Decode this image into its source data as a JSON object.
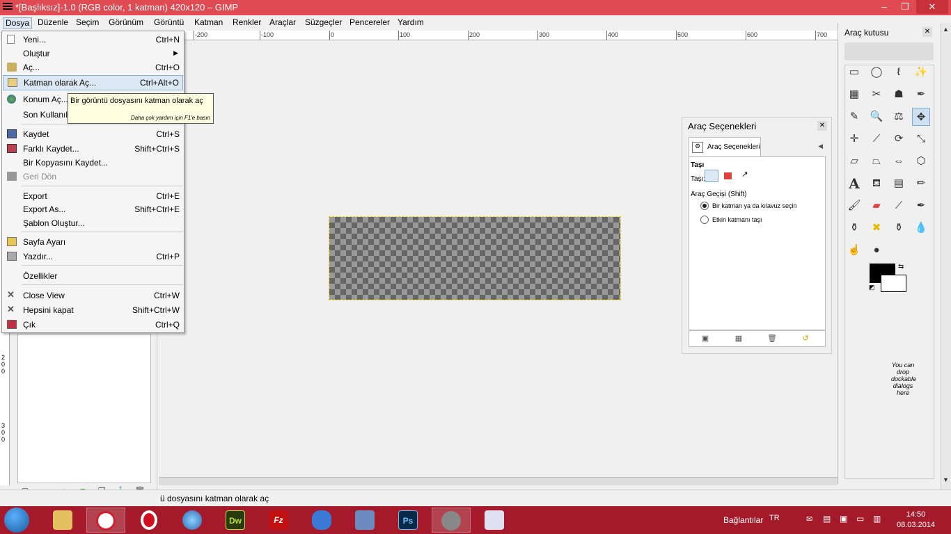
{
  "window": {
    "title": "*[Başlıksız]-1.0 (RGB color, 1 katman) 420x120 – GIMP",
    "minimize": "–",
    "maximize": "❐",
    "close": "✕"
  },
  "menubar": [
    "Dosya",
    "Düzenle",
    "Seçim",
    "Görünüm",
    "Görüntü",
    "Katman",
    "Renkler",
    "Araçlar",
    "Süzgeçler",
    "Pencereler",
    "Yardım"
  ],
  "ruler_top": [
    "-200",
    "-100",
    "0",
    "100",
    "200",
    "300",
    "400",
    "500",
    "600",
    "700"
  ],
  "ruler_left": [
    "2",
    "0",
    "0",
    "3",
    "0",
    "0"
  ],
  "file_menu": {
    "items": [
      {
        "label": "Yeni...",
        "accel": "Ctrl+N",
        "icon": "new-icon"
      },
      {
        "label": "Oluştur",
        "accel": "",
        "icon": ""
      },
      {
        "label": "Aç...",
        "accel": "Ctrl+O",
        "icon": "folder-icon"
      },
      {
        "label": "Katman olarak Aç...",
        "accel": "Ctrl+Alt+O",
        "icon": "open-as-layer-icon"
      },
      {
        "label": "Konum Aç...",
        "accel": "",
        "icon": "globe-icon"
      },
      {
        "label": "Son Kullanılan",
        "accel": "",
        "icon": ""
      },
      {
        "label": "Kaydet",
        "accel": "Ctrl+S",
        "icon": "save-icon"
      },
      {
        "label": "Farklı Kaydet...",
        "accel": "Shift+Ctrl+S",
        "icon": "save-as-icon"
      },
      {
        "label": "Bir Kopyasını Kaydet...",
        "accel": "",
        "icon": ""
      },
      {
        "label": "Geri Dön",
        "accel": "",
        "icon": "revert-icon"
      },
      {
        "label": "Export",
        "accel": "Ctrl+E",
        "icon": ""
      },
      {
        "label": "Export As...",
        "accel": "Shift+Ctrl+E",
        "icon": ""
      },
      {
        "label": "Şablon Oluştur...",
        "accel": "",
        "icon": ""
      },
      {
        "label": "Sayfa Ayarı",
        "accel": "",
        "icon": "page-setup-icon"
      },
      {
        "label": "Yazdır...",
        "accel": "Ctrl+P",
        "icon": "print-icon"
      },
      {
        "label": "Özellikler",
        "accel": "",
        "icon": ""
      },
      {
        "label": "Close View",
        "accel": "Ctrl+W",
        "icon": "close-view-icon"
      },
      {
        "label": "Hepsini kapat",
        "accel": "Shift+Ctrl+W",
        "icon": "close-all-icon"
      },
      {
        "label": "Çık",
        "accel": "Ctrl+Q",
        "icon": "quit-icon"
      }
    ]
  },
  "tooltip": {
    "text": "Bir görüntü dosyasını katman olarak aç",
    "help": "Daha çok yardım için F1'e basın"
  },
  "tool_options": {
    "title": "Araç Seçenekleri",
    "tab": "Araç Seçenekleri",
    "section": "Taşı",
    "move_label": "Taşı:",
    "toggle": "Araç Geçişi  (Shift)",
    "radio1": "Bir katman ya da kılavuz seçin",
    "radio2": "Etkin katmanı taşı"
  },
  "toolbox": {
    "title": "Araç kutusu",
    "hint": "You can drop dockable dialogs here",
    "tools": [
      "rect-select-icon",
      "ellipse-select-icon",
      "free-select-icon",
      "fuzzy-select-icon",
      "color-select-icon",
      "scissors-icon",
      "foreground-select-icon",
      "paths-icon",
      "color-picker-icon",
      "zoom-icon",
      "measure-icon",
      "move-icon",
      "align-icon",
      "crop-icon",
      "rotate-icon",
      "scale-icon",
      "shear-icon",
      "perspective-icon",
      "flip-icon",
      "cage-icon",
      "text-icon",
      "bucket-fill-icon",
      "blend-icon",
      "pencil-icon",
      "paintbrush-icon",
      "eraser-icon",
      "airbrush-icon",
      "ink-icon",
      "clone-icon",
      "heal-icon",
      "perspective-clone-icon",
      "blur-icon",
      "smudge-icon",
      "dodge-burn-icon"
    ]
  },
  "status": {
    "text": "ü dosyasını katman olarak aç"
  },
  "taskbar": {
    "items": [
      "Dw",
      "Fz",
      "Ps"
    ],
    "tray_label": "Bağlantılar",
    "lang": "TR",
    "time": "14:50",
    "date": "08.03.2014"
  }
}
